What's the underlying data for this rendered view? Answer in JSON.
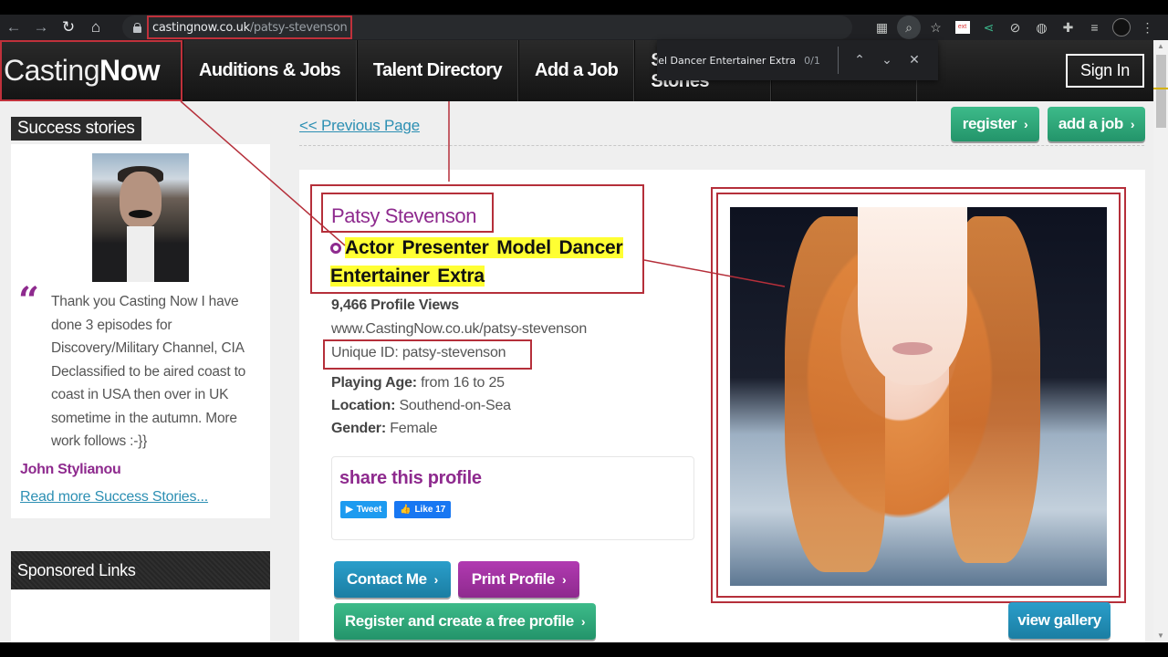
{
  "browser": {
    "url_host": "castingnow.co.uk",
    "url_path": "/patsy-stevenson",
    "nav": {
      "back": "←",
      "forward": "→",
      "reload": "↻",
      "home": "⌂"
    },
    "extensions": [
      "apps-grid-icon",
      "search-page-icon",
      "bookmark-star-icon",
      "red-thumbnail-extension-icon",
      "share-extension-icon",
      "blocked-extension-icon",
      "globe-extension-icon",
      "puzzle-extensions-icon",
      "media-queue-icon",
      "profile-avatar-icon",
      "menu-kebab-icon"
    ],
    "find_bar": {
      "query": "Actor Presenter Model Dancer Entertainer Extra",
      "count": "0/1",
      "prev": "⌃",
      "next": "⌄",
      "close": "✕"
    }
  },
  "site": {
    "logo_light": "Casting",
    "logo_bold": "Now",
    "nav_items": [
      "Auditions & Jobs",
      "Talent Directory",
      "Add a Job",
      "Success Stories"
    ],
    "sign_in": "Sign In"
  },
  "sidebar": {
    "success_title": "Success stories",
    "quote": "Thank you Casting Now I have done 3 episodes for Discovery/Military Channel, CIA Declassified to be aired coast to coast in USA then over in UK sometime in the autumn. More work follows :-}}",
    "quote_mark": "“",
    "author": "John Stylianou",
    "read_more": "Read more Success Stories...",
    "sponsored_title": "Sponsored Links"
  },
  "main": {
    "prev_page": "<< Previous Page",
    "register": "register",
    "add_job": "add a job",
    "profile": {
      "name": "Patsy Stevenson",
      "talents_line1": "Actor Presenter Model Dancer",
      "talents_line2": "Entertainer Extra",
      "views": "9,466 Profile Views",
      "profile_url": "www.CastingNow.co.uk/patsy-stevenson",
      "unique_id": "Unique ID: patsy-stevenson",
      "playing_age_label": "Playing Age:",
      "playing_age": "from 16 to 25",
      "location_label": "Location:",
      "location": "Southend-on-Sea",
      "gender_label": "Gender:",
      "gender": "Female"
    },
    "share": {
      "title": "share this profile",
      "tweet": "Tweet",
      "like": "Like 17"
    },
    "buttons": {
      "contact": "Contact Me",
      "print": "Print Profile",
      "register_free": "Register and create a free profile",
      "view_gallery": "view gallery"
    },
    "chevron": "›"
  },
  "colors": {
    "brand_purple": "#8e2a8e",
    "link_blue": "#2c8fb3",
    "button_green": "#2ea57a",
    "button_blue": "#1f8db8",
    "highlight_yellow": "#ffff33",
    "annotation_red": "#b52f3a"
  }
}
